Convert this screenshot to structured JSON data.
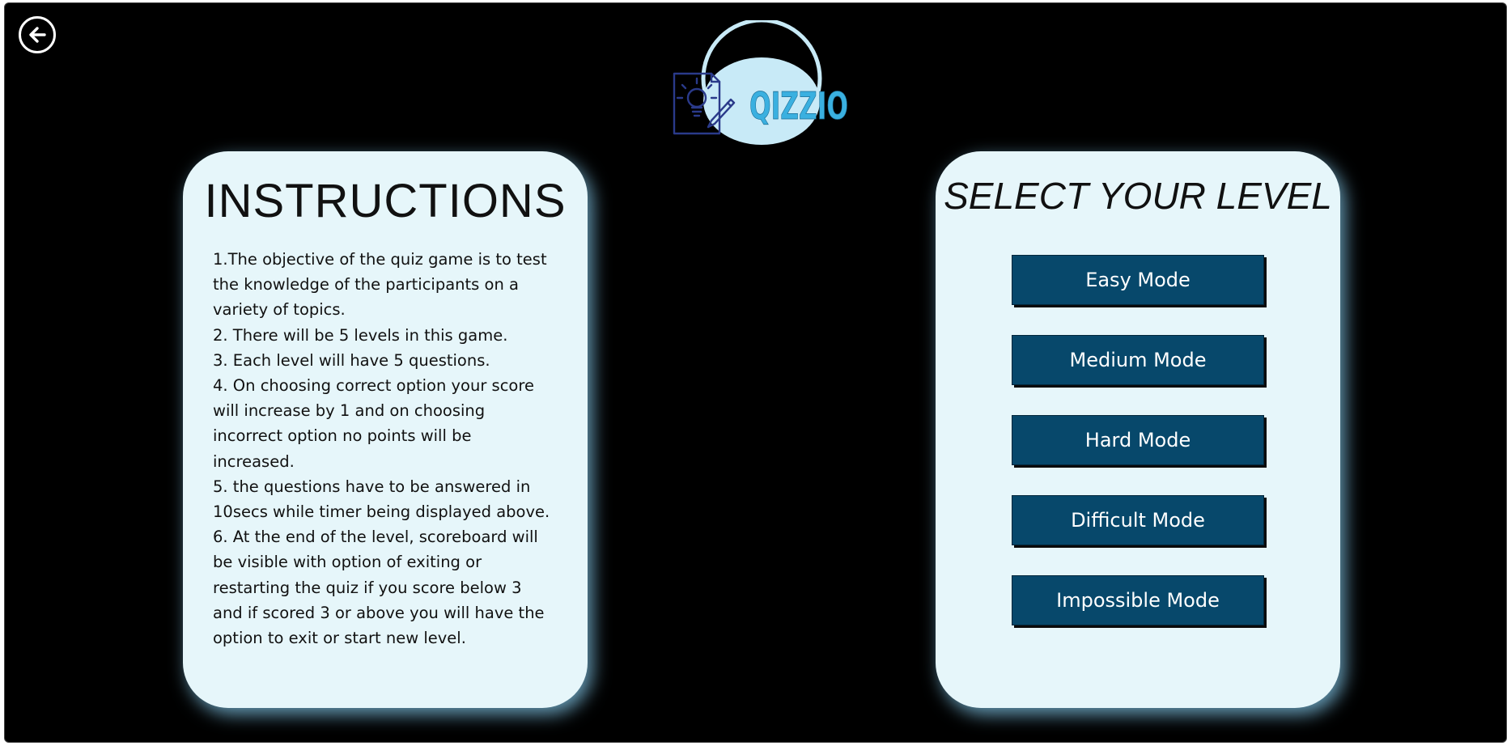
{
  "header": {
    "back_icon": "arrow-left-circle-icon",
    "logo_text": "QIZZIO",
    "logo_icon": "lightbulb-pencil-icon",
    "colors": {
      "logo_circle": "#c8eaf7",
      "logo_text": "#3ab0e0",
      "logo_icon": "#2a3a8a"
    }
  },
  "instructions": {
    "title": "INSTRUCTIONS",
    "lines": [
      "1.The objective of the quiz game is to test",
      "the knowledge of the participants on a",
      "variety of topics.",
      "2. There will be 5 levels in this game.",
      "3. Each level will have 5 questions.",
      "4. On choosing correct option your score",
      "will increase by 1 and on choosing",
      "incorrect option no points will be",
      "increased.",
      "5. the questions have to be answered in",
      "10secs while timer being displayed above.",
      "6. At the end of the level, scoreboard will",
      "be visible with option of exiting or",
      "restarting the quiz if you score below 3",
      "and if scored 3 or above you will have the",
      "option to exit or start new level."
    ]
  },
  "levels": {
    "title": "SELECT YOUR LEVEL",
    "modes": [
      "Easy Mode",
      "Medium Mode",
      "Hard Mode",
      "Difficult Mode",
      "Impossible Mode"
    ]
  },
  "colors": {
    "background": "#000000",
    "panel": "#e6f6fa",
    "panel_glow": "#87cef0",
    "button": "#07486b",
    "button_text": "#ffffff"
  }
}
